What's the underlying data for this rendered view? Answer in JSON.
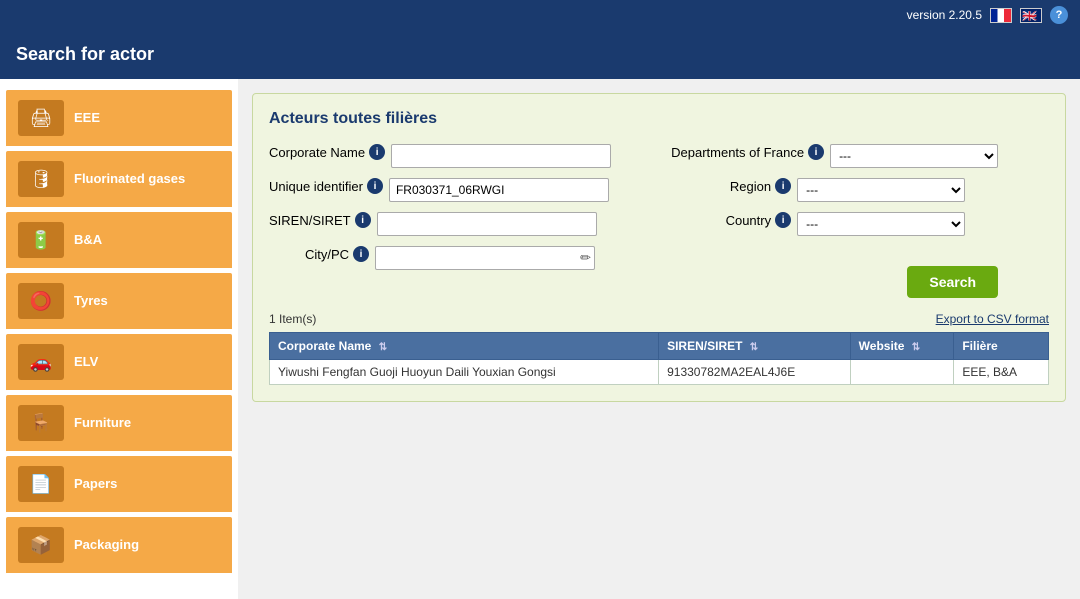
{
  "app": {
    "version": "version 2.20.5",
    "help_label": "?"
  },
  "header": {
    "title": "Search for actor"
  },
  "sidebar": {
    "items": [
      {
        "id": "EEE",
        "label": "EEE",
        "icon": "🖨"
      },
      {
        "id": "fluorinated-gases",
        "label": "Fluorinated gases",
        "icon": "🛢"
      },
      {
        "id": "ba",
        "label": "B&A",
        "icon": "🔋"
      },
      {
        "id": "tyres",
        "label": "Tyres",
        "icon": "⭕"
      },
      {
        "id": "elv",
        "label": "ELV",
        "icon": "🚗"
      },
      {
        "id": "furniture",
        "label": "Furniture",
        "icon": "🪑"
      },
      {
        "id": "papers",
        "label": "Papers",
        "icon": "📄"
      },
      {
        "id": "packaging",
        "label": "Packaging",
        "icon": "📦"
      }
    ]
  },
  "panel": {
    "title": "Acteurs toutes filières"
  },
  "form": {
    "corporate_name_label": "Corporate Name",
    "corporate_name_value": "",
    "corporate_name_placeholder": "",
    "unique_identifier_label": "Unique identifier",
    "unique_identifier_value": "FR030371_06RWGI",
    "siren_label": "SIREN/SIRET",
    "siren_value": "",
    "city_label": "City/PC",
    "city_value": "",
    "departments_label": "Departments of France",
    "departments_value": "---",
    "departments_options": [
      "---"
    ],
    "region_label": "Region",
    "region_value": "---",
    "region_options": [
      "---"
    ],
    "country_label": "Country",
    "country_value": "---",
    "country_options": [
      "---"
    ],
    "search_button": "Search"
  },
  "results": {
    "count_label": "1 Item(s)",
    "export_label": "Export to CSV format",
    "columns": [
      {
        "key": "corporate_name",
        "label": "Corporate Name"
      },
      {
        "key": "siren_siret",
        "label": "SIREN/SIRET"
      },
      {
        "key": "website",
        "label": "Website"
      },
      {
        "key": "filiere",
        "label": "Filière"
      }
    ],
    "rows": [
      {
        "corporate_name": "Yiwushi Fengfan Guoji Huoyun Daili Youxian Gongsi",
        "siren_siret": "91330782MA2EAL4J6E",
        "website": "",
        "filiere": "EEE, B&A"
      }
    ]
  }
}
